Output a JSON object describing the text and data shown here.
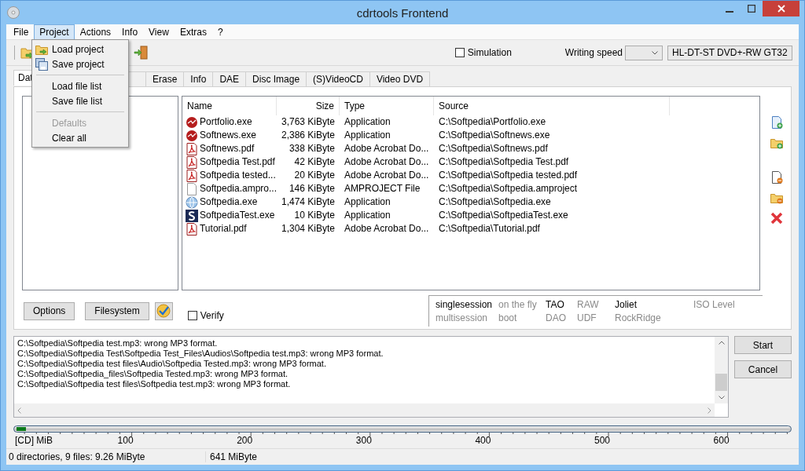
{
  "window": {
    "title": "cdrtools Frontend"
  },
  "menu": [
    {
      "label": "File",
      "selected": false
    },
    {
      "label": "Project",
      "selected": true
    },
    {
      "label": "Actions",
      "selected": false
    },
    {
      "label": "Info",
      "selected": false
    },
    {
      "label": "View",
      "selected": false
    },
    {
      "label": "Extras",
      "selected": false
    },
    {
      "label": "?",
      "selected": false
    }
  ],
  "project_menu": [
    {
      "kind": "load",
      "label": "Load project",
      "disabled": false
    },
    {
      "kind": "save",
      "label": "Save project",
      "disabled": false
    },
    {
      "kind": "separator"
    },
    {
      "kind": "item",
      "label": "Load file list",
      "disabled": false
    },
    {
      "kind": "item",
      "label": "Save file list",
      "disabled": false
    },
    {
      "kind": "separator"
    },
    {
      "kind": "item",
      "label": "Defaults",
      "disabled": true
    },
    {
      "kind": "item",
      "label": "Clear all",
      "disabled": false
    }
  ],
  "toolbar": {
    "simulation": {
      "label": "Simulation",
      "checked": false
    },
    "writing_speed": {
      "label": "Writing speed"
    },
    "drive": {
      "value": "HL-DT-ST DVD+-RW GT32"
    }
  },
  "tabs": [
    {
      "label": "Dat",
      "selected": true
    },
    {
      "selected": false
    },
    {
      "label": "Erase",
      "selected": false
    },
    {
      "label": "Info",
      "selected": false
    },
    {
      "label": "DAE",
      "selected": false
    },
    {
      "label": "Disc Image",
      "selected": false
    },
    {
      "label": "(S)VideoCD",
      "selected": false
    },
    {
      "label": "Video DVD",
      "selected": false
    }
  ],
  "file_list": {
    "columns": [
      "Name",
      "Size",
      "Type",
      "Source"
    ],
    "rows": [
      {
        "kind": "exe",
        "name": "Portfolio.exe",
        "size": "3,763 KiByte",
        "type": "Application",
        "source": "C:\\Softpedia\\Portfolio.exe"
      },
      {
        "kind": "exe",
        "name": "Softnews.exe",
        "size": "2,386 KiByte",
        "type": "Application",
        "source": "C:\\Softpedia\\Softnews.exe"
      },
      {
        "kind": "pdf",
        "name": "Softnews.pdf",
        "size": "338 KiByte",
        "type": "Adobe Acrobat Do...",
        "source": "C:\\Softpedia\\Softnews.pdf"
      },
      {
        "kind": "pdf",
        "name": "Softpedia Test.pdf",
        "size": "42 KiByte",
        "type": "Adobe Acrobat Do...",
        "source": "C:\\Softpedia\\Softpedia Test.pdf"
      },
      {
        "kind": "pdf",
        "name": "Softpedia tested...",
        "size": "20 KiByte",
        "type": "Adobe Acrobat Do...",
        "source": "C:\\Softpedia\\Softpedia tested.pdf"
      },
      {
        "kind": "file",
        "name": "Softpedia.ampro...",
        "size": "146 KiByte",
        "type": "AMPROJECT File",
        "source": "C:\\Softpedia\\Softpedia.amproject"
      },
      {
        "kind": "setup",
        "name": "Softpedia.exe",
        "size": "1,474 KiByte",
        "type": "Application",
        "source": "C:\\Softpedia\\Softpedia.exe"
      },
      {
        "kind": "s",
        "name": "SoftpediaTest.exe",
        "size": "10 KiByte",
        "type": "Application",
        "source": "C:\\Softpedia\\SoftpediaTest.exe"
      },
      {
        "kind": "pdf",
        "name": "Tutorial.pdf",
        "size": "1,304 KiByte",
        "type": "Adobe Acrobat Do...",
        "source": "C:\\Softpedia\\Tutorial.pdf"
      }
    ]
  },
  "buttons": [
    "Options",
    "Filesystem"
  ],
  "verify": {
    "label": "Verify",
    "checked": false
  },
  "session_flags": [
    [
      {
        "label": "singlesession",
        "active": true
      },
      {
        "label": "on the fly",
        "active": false
      },
      {
        "label": "TAO",
        "active": true
      },
      {
        "label": "RAW",
        "active": false
      },
      {
        "label": "Joliet",
        "active": true
      },
      {
        "label": "ISO Level",
        "active": false
      }
    ],
    [
      {
        "label": "multisession",
        "active": false
      },
      {
        "label": "boot",
        "active": false
      },
      {
        "label": "DAO",
        "active": false
      },
      {
        "label": "UDF",
        "active": false
      },
      {
        "label": "RockRidge",
        "active": false
      }
    ]
  ],
  "log": [
    "C:\\Softpedia\\Softpedia test.mp3: wrong MP3 format.",
    "C:\\Softpedia\\Softpedia Test\\Softpedia Test_Files\\Audios\\Softpedia test.mp3: wrong MP3 format.",
    "C:\\Softpedia\\Softpedia test files\\Audio\\Softpedia Tested.mp3: wrong MP3 format.",
    "C:\\Softpedia\\Softpedia_files\\Softpedia Tested.mp3: wrong MP3 format.",
    "C:\\Softpedia\\Softpedia test files\\Softpedia test.mp3: wrong MP3 format."
  ],
  "actions": [
    "Start",
    "Cancel"
  ],
  "capacity": {
    "level": 0.012,
    "unit": "[CD] MiB",
    "scale": [
      "100",
      "200",
      "300",
      "400",
      "500",
      "600"
    ]
  },
  "status_bar": [
    "0 directories, 9 files: 9.26 MiByte",
    "641 MiByte"
  ]
}
